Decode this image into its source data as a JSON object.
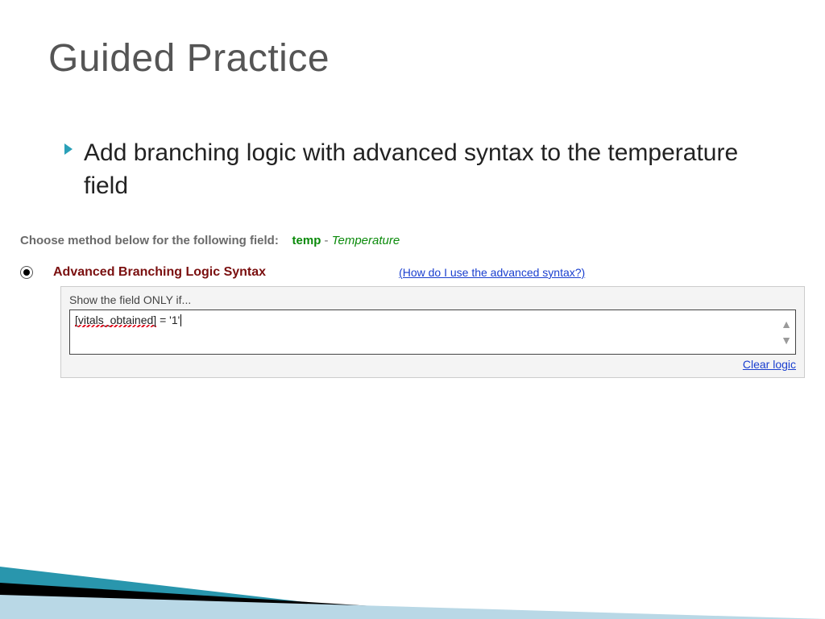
{
  "title": "Guided Practice",
  "bullet": "Add branching logic with advanced syntax to the temperature field",
  "choose": {
    "lead": "Choose method below for the following field:",
    "fieldname": "temp",
    "dash": "-",
    "fielddesc": "Temperature"
  },
  "option": {
    "label": "Advanced Branching Logic Syntax",
    "help": "(How do I use the advanced syntax?)"
  },
  "panel": {
    "caption": "Show the field ONLY if...",
    "value_variable": "[vitals_obtained]",
    "value_rest": " = '1'",
    "clear": "Clear logic"
  }
}
